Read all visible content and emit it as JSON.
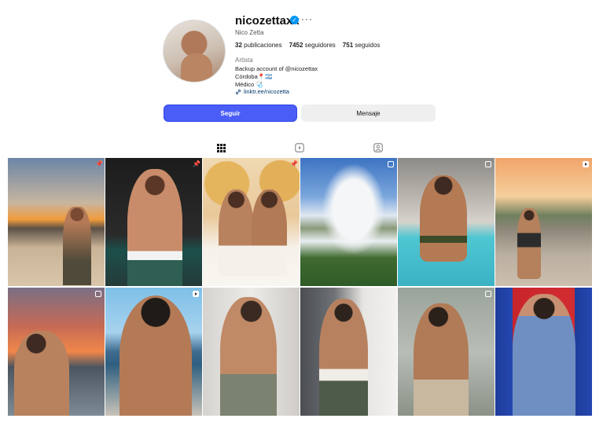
{
  "profile": {
    "username": "nicozettaxx",
    "full_name": "Nico Zetta",
    "stats": {
      "posts": "32",
      "posts_label": "publicaciones",
      "followers": "7452",
      "followers_label": "seguidores",
      "following": "751",
      "following_label": "seguidos"
    },
    "category": "Artista",
    "bio": [
      "Backup account of @nicozettax",
      "Córdoba📍🇦🇷",
      "Médico 🩺"
    ],
    "link": "linktr.ee/nicozetta"
  },
  "buttons": {
    "follow": "Seguir",
    "message": "Mensaje"
  },
  "tabs": [
    "grid-icon",
    "reels-icon",
    "tagged-icon"
  ],
  "colors": {
    "follow": "#4a5ef7",
    "verified": "#0095f6",
    "link": "#00376b"
  },
  "posts": [
    {
      "badge": "pin"
    },
    {
      "badge": "pin"
    },
    {
      "badge": "pin"
    },
    {
      "badge": "carousel"
    },
    {
      "badge": "carousel"
    },
    {
      "badge": "reel"
    },
    {
      "badge": "carousel"
    },
    {
      "badge": "reel"
    },
    {
      "badge": "none"
    },
    {
      "badge": "none"
    },
    {
      "badge": "carousel"
    },
    {
      "badge": "none"
    }
  ]
}
